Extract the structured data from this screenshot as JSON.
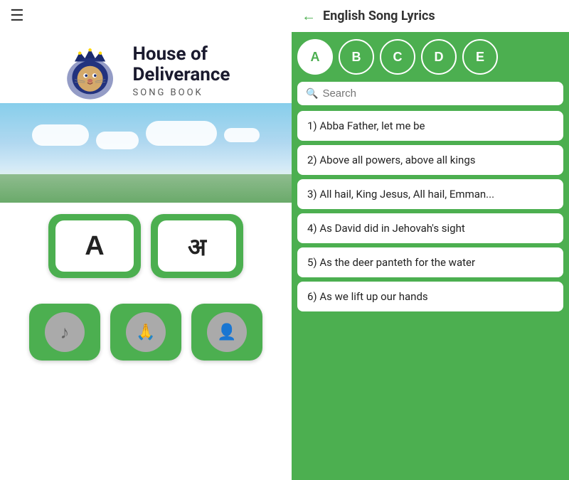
{
  "left": {
    "hamburger_label": "☰",
    "app_title_line1": "House of",
    "app_title_line2": "Deliverance",
    "app_subtitle": "SONG BOOK",
    "english_button_label": "A",
    "hindi_button_label": "अ",
    "icon_music": "♪",
    "icon_prayer": "🙏",
    "icon_contact": "👤"
  },
  "right": {
    "title": "English Song Lyrics",
    "back_arrow": "←",
    "search_placeholder": "Search",
    "alphabet_tabs": [
      {
        "label": "A",
        "active": true
      },
      {
        "label": "B",
        "active": false
      },
      {
        "label": "C",
        "active": false
      },
      {
        "label": "D",
        "active": false
      },
      {
        "label": "E",
        "active": false
      }
    ],
    "songs": [
      {
        "number": "1)",
        "title": "Abba Father, let me be"
      },
      {
        "number": "2)",
        "title": "Above all powers, above all kings"
      },
      {
        "number": "3)",
        "title": "All hail, King Jesus, All hail, Emman..."
      },
      {
        "number": "4)",
        "title": "As David did in Jehovah's sight"
      },
      {
        "number": "5)",
        "title": "As the deer panteth for the water"
      },
      {
        "number": "6)",
        "title": "As we lift up our hands"
      }
    ]
  }
}
